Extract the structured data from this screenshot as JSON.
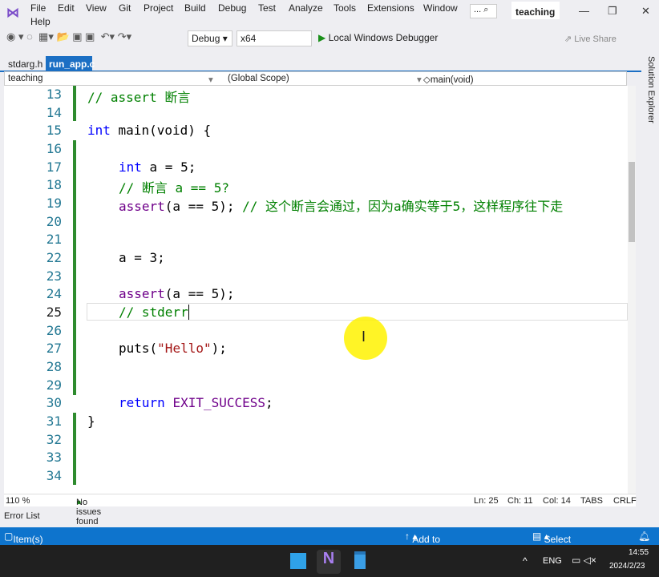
{
  "menu": [
    "File",
    "Edit",
    "View",
    "Git",
    "Project",
    "Build",
    "Debug",
    "Test",
    "Analyze",
    "Tools",
    "Extensions",
    "Window",
    "Help"
  ],
  "search_label": "...",
  "solution_title": "teaching",
  "toolbar": {
    "config": "Debug",
    "platform": "x64",
    "run_label": "Local Windows Debugger",
    "live_share": "Live Share"
  },
  "tabs": [
    {
      "label": "stdarg.h"
    },
    {
      "label": "run_app.c",
      "pin": "⊕",
      "close": "✕"
    }
  ],
  "nav": {
    "project": "teaching",
    "scope": "(Global Scope)",
    "member": "main(void)"
  },
  "side_panel": "Solution Explorer",
  "code": [
    {
      "n": "13",
      "t": "// assert 断言",
      "cls": "cm",
      "indent": 0
    },
    {
      "n": "14",
      "t": "",
      "indent": 0
    },
    {
      "n": "15",
      "parts": [
        {
          "t": "int",
          "c": "kw"
        },
        {
          "t": " main(void) {"
        }
      ],
      "indent": 0
    },
    {
      "n": "16",
      "t": "",
      "indent": 0
    },
    {
      "n": "17",
      "parts": [
        {
          "t": "int",
          "c": "kw"
        },
        {
          "t": " a = 5;"
        }
      ],
      "indent": 1
    },
    {
      "n": "18",
      "t": "// 断言 a == 5?",
      "cls": "cm",
      "indent": 1
    },
    {
      "n": "19",
      "parts": [
        {
          "t": "assert",
          "c": "mac"
        },
        {
          "t": "(a == 5); "
        },
        {
          "t": "// 这个断言会通过，因为a确实等于5，这样程序往下走",
          "c": "cm"
        }
      ],
      "indent": 1
    },
    {
      "n": "20",
      "t": "",
      "indent": 0
    },
    {
      "n": "21",
      "t": "",
      "indent": 0
    },
    {
      "n": "22",
      "t": "a = 3;",
      "indent": 1
    },
    {
      "n": "23",
      "t": "",
      "indent": 0
    },
    {
      "n": "24",
      "parts": [
        {
          "t": "assert",
          "c": "mac"
        },
        {
          "t": "(a == 5);"
        }
      ],
      "indent": 1
    },
    {
      "n": "25",
      "t": "// stderr",
      "cls": "cm",
      "indent": 1
    },
    {
      "n": "26",
      "t": "",
      "indent": 0
    },
    {
      "n": "27",
      "parts": [
        {
          "t": "puts("
        },
        {
          "t": "\"Hello\"",
          "c": "str"
        },
        {
          "t": ");"
        }
      ],
      "indent": 1
    },
    {
      "n": "28",
      "t": "",
      "indent": 0
    },
    {
      "n": "29",
      "t": "",
      "indent": 0
    },
    {
      "n": "30",
      "parts": [
        {
          "t": "return",
          "c": "kw"
        },
        {
          "t": " "
        },
        {
          "t": "EXIT_SUCCESS",
          "c": "mac"
        },
        {
          "t": ";"
        }
      ],
      "indent": 1
    },
    {
      "n": "31",
      "t": "}",
      "indent": 0
    },
    {
      "n": "32",
      "t": "",
      "indent": 0
    },
    {
      "n": "33",
      "t": "",
      "indent": 0
    },
    {
      "n": "34",
      "t": "",
      "indent": 0
    }
  ],
  "current_line": "25",
  "status": {
    "zoom": "110 %",
    "issues": "No issues found",
    "ln": "Ln: 25",
    "ch": "Ch: 11",
    "col": "Col: 14",
    "tabs": "TABS",
    "eol": "CRLF"
  },
  "error_list": "Error List",
  "bottom": {
    "saved": "Item(s) Saved",
    "source_control": "Add to Source Control",
    "repo": "Select Repository"
  },
  "taskbar": {
    "lang": "ENG",
    "time": "14:55",
    "date": "2024/2/23"
  }
}
